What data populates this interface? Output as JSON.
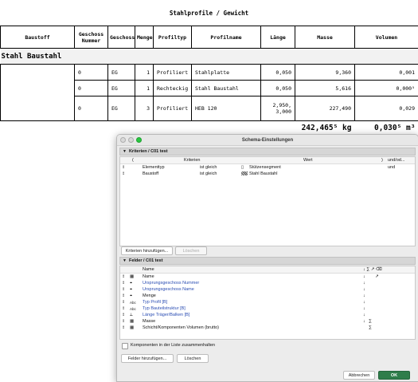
{
  "schedule": {
    "title": "Stahlprofile / Gewicht",
    "headers": [
      "Baustoff",
      "Geschoss Nummer",
      "Geschoss",
      "Menge",
      "Profiltyp",
      "Profilname",
      "Länge",
      "Masse",
      "Volumen"
    ],
    "group_label": "Stahl Baustahl",
    "rows": [
      [
        "",
        "0",
        "EG",
        "1",
        "Profiliert",
        "Stahlplatte",
        "0,050",
        "9,360",
        "0,001"
      ],
      [
        "",
        "0",
        "EG",
        "1",
        "Rechteckig",
        "Stahl Baustahl",
        "0,050",
        "5,616",
        "0,000⁵"
      ],
      [
        "",
        "0",
        "EG",
        "3",
        "Profiliert",
        "HEB 120",
        "2,950, 3,000",
        "227,490",
        "0,029"
      ]
    ],
    "total_mass": "242,465⁵ kg",
    "total_volume": "0,030⁵ m³"
  },
  "dialog": {
    "title": "Schema-Einstellungen",
    "criteria": {
      "section_title": "Kriterien / C01 test",
      "col_paren_open": "(",
      "col_criteria": "Kriterien",
      "col_value": "Wert",
      "col_paren_close": ")",
      "col_andor": "und/od...",
      "rows": [
        {
          "field": "Elementtyp",
          "op": "ist gleich",
          "value": "Stützensegment",
          "andor": "und"
        },
        {
          "field": "Baustoff",
          "op": "ist gleich",
          "value": "Stahl Baustahl",
          "andor": ""
        }
      ],
      "add_button": "Kriterien hinzufügen...",
      "delete_button": "Löschen"
    },
    "fields": {
      "section_title": "Felder / C01 test",
      "col_name": "Name",
      "col_sort_icons": "↓ ∑ ↗ ⌫",
      "rows": [
        {
          "name": "Name",
          "blue": false,
          "sort": "↓",
          "sum": "",
          "extra": "↗"
        },
        {
          "name": "Ursprungsgeschoss Nummer",
          "blue": true,
          "sort": "↓",
          "sum": "",
          "extra": ""
        },
        {
          "name": "Ursprungsgeschoss Name",
          "blue": true,
          "sort": "↓",
          "sum": "",
          "extra": ""
        },
        {
          "name": "Menge",
          "blue": false,
          "sort": "↓",
          "sum": "",
          "extra": ""
        },
        {
          "name": "Typ Profil [B]",
          "blue": true,
          "sort": "↓",
          "sum": "",
          "extra": ""
        },
        {
          "name": "Typ Bauteilstruktur [B]",
          "blue": true,
          "sort": "↓",
          "sum": "",
          "extra": ""
        },
        {
          "name": "Länge Träger/Balken [B]",
          "blue": true,
          "sort": "↓",
          "sum": "",
          "extra": ""
        },
        {
          "name": "Masse",
          "blue": false,
          "sort": "↓",
          "sum": "∑",
          "extra": ""
        },
        {
          "name": "Schicht/Komponenten Volumen (brutto)",
          "blue": false,
          "sort": "",
          "sum": "∑",
          "extra": ""
        }
      ],
      "checkbox_label": "Komponenten in der Liste zusammenhalten",
      "add_button": "Felder hinzufügen...",
      "delete_button": "Löschen"
    },
    "cancel_button": "Abbrechen",
    "ok_button": "OK",
    "colors": {
      "ok": "#2f7d4a",
      "close": "#ff5f57",
      "minimize": "#febc2e",
      "zoom": "#28c840"
    }
  }
}
